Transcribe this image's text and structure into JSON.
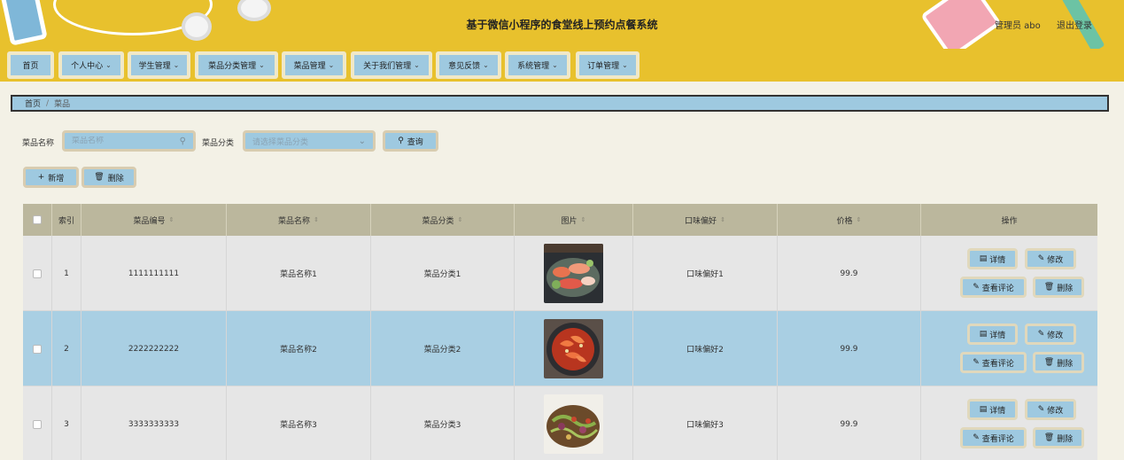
{
  "header": {
    "title": "基于微信小程序的食堂线上预约点餐系统",
    "user": "管理员 abo",
    "logout": "退出登录"
  },
  "nav": [
    {
      "label": "首页",
      "dropdown": false
    },
    {
      "label": "个人中心",
      "dropdown": true
    },
    {
      "label": "学生管理",
      "dropdown": true
    },
    {
      "label": "菜品分类管理",
      "dropdown": true
    },
    {
      "label": "菜品管理",
      "dropdown": true
    },
    {
      "label": "关于我们管理",
      "dropdown": true
    },
    {
      "label": "意见反馈",
      "dropdown": true
    },
    {
      "label": "系统管理",
      "dropdown": true
    },
    {
      "label": "订单管理",
      "dropdown": true
    }
  ],
  "breadcrumb": {
    "home": "首页",
    "current": "菜品"
  },
  "search": {
    "name_label": "菜品名称",
    "name_placeholder": "菜品名称",
    "category_label": "菜品分类",
    "category_placeholder": "请选择菜品分类",
    "query_button": "查询"
  },
  "actions": {
    "add": "新增",
    "delete": "删除"
  },
  "table": {
    "columns": [
      "索引",
      "菜品编号",
      "菜品名称",
      "菜品分类",
      "图片",
      "口味偏好",
      "价格",
      "操作"
    ],
    "rows": [
      {
        "index": "1",
        "code": "1111111111",
        "name": "菜品名称1",
        "category": "菜品分类1",
        "flavor": "口味偏好1",
        "price": "99.9"
      },
      {
        "index": "2",
        "code": "2222222222",
        "name": "菜品名称2",
        "category": "菜品分类2",
        "flavor": "口味偏好2",
        "price": "99.9"
      },
      {
        "index": "3",
        "code": "3333333333",
        "name": "菜品名称3",
        "category": "菜品分类3",
        "flavor": "口味偏好3",
        "price": "99.9"
      }
    ],
    "row_ops": {
      "detail": "详情",
      "edit": "修改",
      "comments": "查看评论",
      "delete": "删除"
    }
  }
}
